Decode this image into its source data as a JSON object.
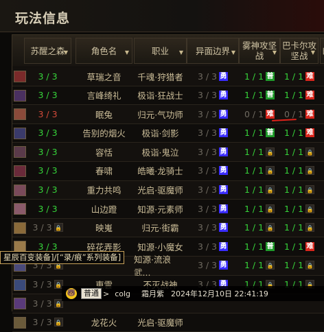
{
  "window": {
    "title": "玩法信息"
  },
  "columns": [
    {
      "key": "suxing",
      "label": "苏醒之森",
      "sortable": true
    },
    {
      "key": "name",
      "label": "角色名",
      "sortable": true
    },
    {
      "key": "job",
      "label": "职业",
      "sortable": true
    },
    {
      "key": "yijie",
      "label": "异面边界",
      "sortable": true
    },
    {
      "key": "wushen",
      "label": "雾神攻坚\n战",
      "sortable": true
    },
    {
      "key": "bakaer",
      "label": "巴卡尔攻\n坚战",
      "sortable": true
    },
    {
      "key": "extra",
      "label": "幽",
      "sortable": false
    }
  ],
  "badges": {
    "yong": "勇",
    "pu": "普",
    "nan": "难",
    "lock": "🔒"
  },
  "rows": [
    {
      "suxing": "3 / 3",
      "suxing_color": "green",
      "name": "草瑞之音",
      "job": "千魂·狩猎者",
      "yijie": "3 / 3",
      "yijie_badge": "yong",
      "wushen": "1 / 1",
      "wushen_color": "green",
      "wushen_badge": "pu",
      "bakaer": "1 / 1",
      "bakaer_color": "green",
      "bakaer_badge": "nan",
      "avatar": "#7a2a2a"
    },
    {
      "suxing": "3 / 3",
      "suxing_color": "green",
      "name": "言峰绮礼",
      "job": "极诣·狂战士",
      "yijie": "3 / 3",
      "yijie_badge": "yong",
      "wushen": "1 / 1",
      "wushen_color": "green",
      "wushen_badge": "pu",
      "bakaer": "1 / 1",
      "bakaer_color": "green",
      "bakaer_badge": "nan",
      "avatar": "#4a3060"
    },
    {
      "suxing": "3 / 3",
      "suxing_color": "red",
      "name": "眠兔",
      "job": "归元·气功师",
      "yijie": "3 / 3",
      "yijie_badge": "yong",
      "wushen": "0 / 1",
      "wushen_color": "gray",
      "wushen_badge": "nan",
      "bakaer": "0 / 1",
      "bakaer_color": "gray",
      "bakaer_badge": "nan",
      "avatar": "#8a4a3a"
    },
    {
      "suxing": "3 / 3",
      "suxing_color": "green",
      "name": "告别的烟火",
      "job": "极诣·剑影",
      "yijie": "3 / 3",
      "yijie_badge": "yong",
      "wushen": "1 / 1",
      "wushen_color": "green",
      "wushen_badge": "pu",
      "bakaer": "1 / 1",
      "bakaer_color": "green",
      "bakaer_badge": "nan",
      "avatar": "#3a3a6a"
    },
    {
      "suxing": "3 / 3",
      "suxing_color": "green",
      "name": "容恬",
      "job": "极诣·鬼泣",
      "yijie": "3 / 3",
      "yijie_badge": "yong",
      "wushen": "1 / 1",
      "wushen_color": "green",
      "wushen_badge": "lock",
      "bakaer": "1 / 1",
      "bakaer_color": "green",
      "bakaer_badge": "lock",
      "avatar": "#5a3a4a"
    },
    {
      "suxing": "3 / 3",
      "suxing_color": "green",
      "name": "春啸",
      "job": "皓曦·龙骑士",
      "yijie": "3 / 3",
      "yijie_badge": "yong",
      "wushen": "1 / 1",
      "wushen_color": "green",
      "wushen_badge": "lock",
      "bakaer": "1 / 1",
      "bakaer_color": "green",
      "bakaer_badge": "lock",
      "avatar": "#6a2a3a"
    },
    {
      "suxing": "3 / 3",
      "suxing_color": "green",
      "name": "重力共鸣",
      "job": "光启·驱魔师",
      "yijie": "3 / 3",
      "yijie_badge": "yong",
      "wushen": "1 / 1",
      "wushen_color": "green",
      "wushen_badge": "lock",
      "bakaer": "1 / 1",
      "bakaer_color": "green",
      "bakaer_badge": "lock",
      "avatar": "#7a4a5a"
    },
    {
      "suxing": "3 / 3",
      "suxing_color": "green",
      "name": "山边蹬",
      "job": "知源·元素师",
      "yijie": "3 / 3",
      "yijie_badge": "yong",
      "wushen": "1 / 1",
      "wushen_color": "green",
      "wushen_badge": "lock",
      "bakaer": "1 / 1",
      "bakaer_color": "green",
      "bakaer_badge": "lock",
      "avatar": "#8a5a6a"
    },
    {
      "suxing": "3 / 3",
      "suxing_color": "gray",
      "suxing_lock": true,
      "name": "映嵬",
      "job": "归元·街霸",
      "yijie": "3 / 3",
      "yijie_badge": "yong",
      "wushen": "1 / 1",
      "wushen_color": "green",
      "wushen_badge": "lock",
      "bakaer": "1 / 1",
      "bakaer_color": "green",
      "bakaer_badge": "lock",
      "avatar": "#8a6a3a"
    },
    {
      "suxing": "3 / 3",
      "suxing_color": "green",
      "name": "碎花弄影",
      "job": "知源·小魔女",
      "yijie": "3 / 3",
      "yijie_badge": "yong",
      "wushen": "1 / 1",
      "wushen_color": "green",
      "wushen_badge": "pu",
      "bakaer": "1 / 1",
      "bakaer_color": "green",
      "bakaer_badge": "nan",
      "avatar": "#9a7a4a"
    },
    {
      "suxing": "3 / 3",
      "suxing_color": "gray",
      "suxing_lock": true,
      "name": "",
      "job": "知源·流浪武...",
      "yijie": "3 / 3",
      "yijie_badge": "yong",
      "wushen": "1 / 1",
      "wushen_color": "green",
      "wushen_badge": "lock",
      "bakaer": "1 / 1",
      "bakaer_color": "green",
      "bakaer_badge": "lock",
      "avatar": "#4a4a7a"
    },
    {
      "suxing": "3 / 3",
      "suxing_color": "gray",
      "suxing_lock": true,
      "name": "東雲",
      "job": "不灭战神",
      "yijie": "3 / 3",
      "yijie_badge": "yong",
      "wushen": "1 / 1",
      "wushen_color": "green",
      "wushen_badge": "lock",
      "bakaer": "1 / 1",
      "bakaer_color": "green",
      "bakaer_badge": "lock",
      "avatar": "#3a4a7a"
    },
    {
      "suxing": "3 / 3",
      "suxing_color": "gray",
      "suxing_lock": true,
      "name": "",
      "job": "",
      "yijie": "",
      "yijie_badge": "",
      "wushen": "",
      "wushen_color": "gray",
      "wushen_badge": "",
      "bakaer": "",
      "bakaer_color": "gray",
      "bakaer_badge": "",
      "avatar": "#5a3a7a"
    },
    {
      "suxing": "3 / 3",
      "suxing_color": "gray",
      "suxing_lock": true,
      "name": "龙花火",
      "job": "光启·驱魔师",
      "yijie": "",
      "yijie_badge": "",
      "wushen": "",
      "wushen_color": "gray",
      "wushen_badge": "",
      "bakaer": "",
      "bakaer_color": "gray",
      "bakaer_badge": "",
      "avatar": "#6a5a3a"
    }
  ],
  "tooltip": {
    "text": "星辰百变装备]/[“录/痕”系列装备]"
  },
  "chat": {
    "emoji": "🐻",
    "channel": "普通",
    "separator": ">",
    "sender": "colg",
    "name": "霜月紫",
    "time": "2024年12月10日 22:41:19"
  }
}
